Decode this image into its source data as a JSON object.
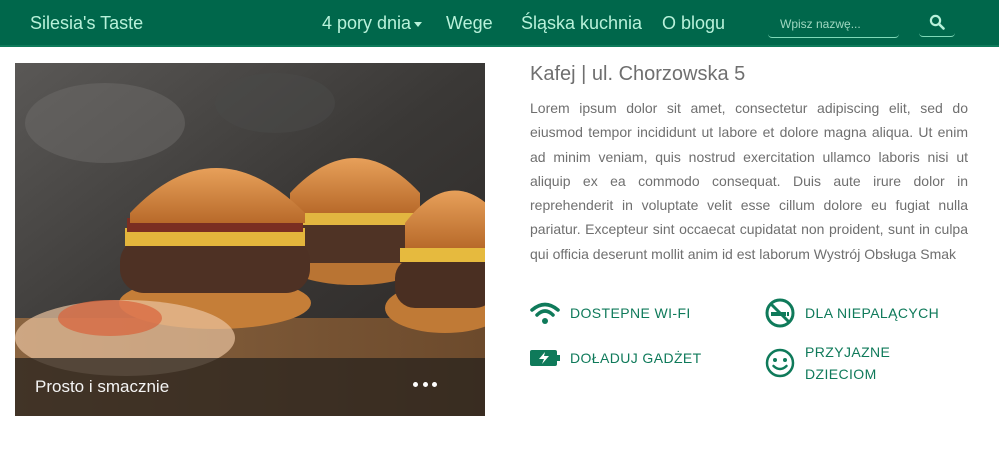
{
  "navbar": {
    "brand": "Silesia's Taste",
    "links": [
      "4 pory dnia",
      "Wege",
      "Śląska kuchnia",
      "O blogu"
    ],
    "search_placeholder": "Wpisz nazwę..."
  },
  "card": {
    "caption": "Prosto i smacznie"
  },
  "venue": {
    "title": "Kafej | ul. Chorzowska 5",
    "description": "Lorem ipsum dolor sit amet, consectetur adipiscing elit, sed do eiusmod tempor incididunt ut labore et dolore magna aliqua. Ut enim ad minim veniam, quis nostrud exercitation ullamco laboris nisi ut aliquip ex ea commodo consequat. Duis aute irure dolor in reprehenderit in voluptate velit esse cillum dolore eu fugiat nulla pariatur. Excepteur sint occaecat cupidatat non proident, sunt in culpa qui officia deserunt mollit anim id est laborum Wystrój Obsługa Smak"
  },
  "features": [
    {
      "icon": "wifi-icon",
      "label": "DOSTEPNE WI-FI"
    },
    {
      "icon": "no-smoking-icon",
      "label": "DLA NIEPALĄCYCH"
    },
    {
      "icon": "battery-charging-icon",
      "label": "DOŁADUJ GADŻET"
    },
    {
      "icon": "smiley-icon",
      "label": "PRZYJAZNE DZIECIOM"
    }
  ],
  "colors": {
    "navbar": "#00674b",
    "nav_text": "#b8f1da",
    "accent": "#0f7a5a",
    "body_text": "#6f6f6f"
  }
}
